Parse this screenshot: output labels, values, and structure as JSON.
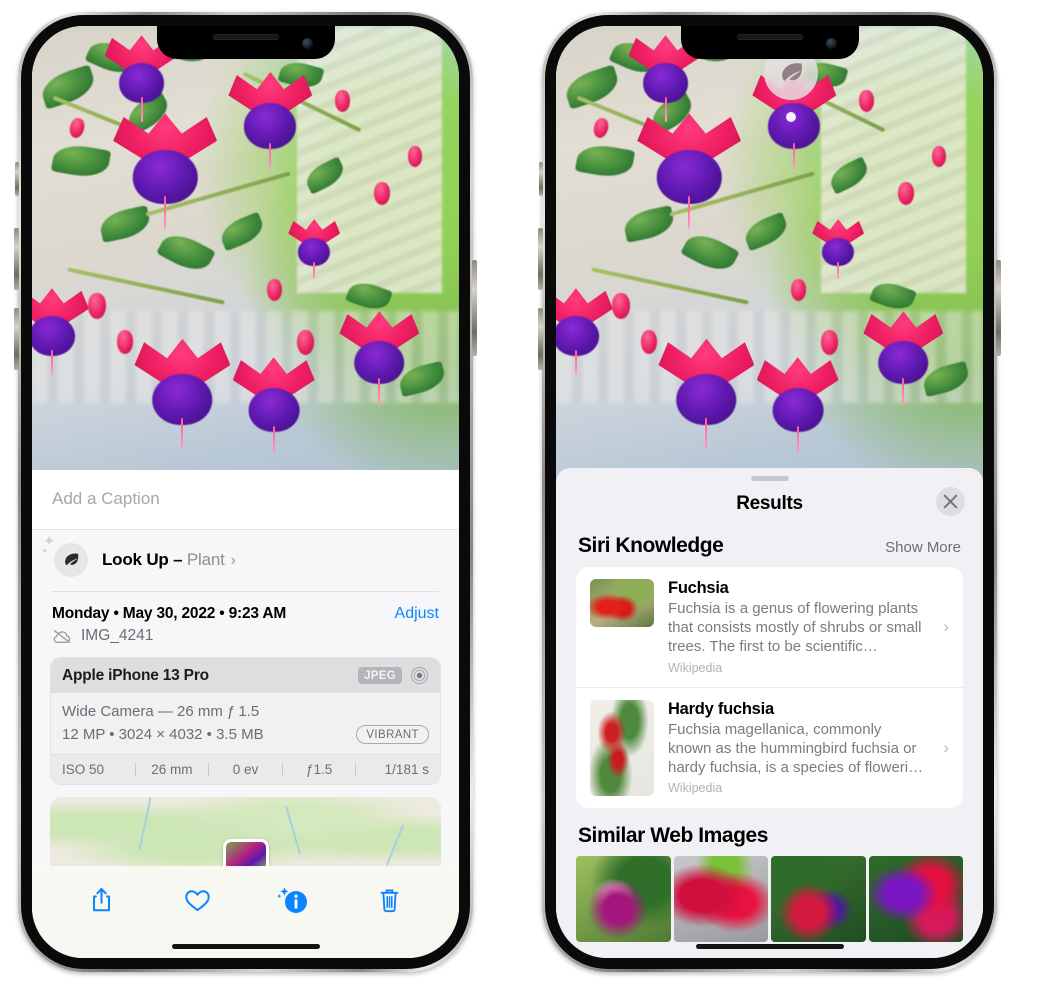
{
  "left_phone": {
    "caption": {
      "placeholder": "Add a Caption",
      "value": ""
    },
    "lookup": {
      "icon": "leaf-icon",
      "label": "Look Up – ",
      "subject": "Plant",
      "chevron": "›"
    },
    "meta": {
      "date": "Monday • May 30, 2022 • 9:23 AM",
      "adjust_label": "Adjust",
      "filename": "IMG_4241",
      "cloud_icon": "cloud-slash-icon"
    },
    "camera_card": {
      "model": "Apple iPhone 13 Pro",
      "format_badge": "JPEG",
      "lens_icon": "lens-icon",
      "lens_line": "Wide Camera — 26 mm ƒ 1.5",
      "size_line": "12 MP • 3024 × 4032 • 3.5 MB",
      "quality_badge": "VIBRANT",
      "exif": [
        "ISO 50",
        "26 mm",
        "0 ev",
        "ƒ1.5",
        "1/181 s"
      ]
    },
    "toolbar": [
      {
        "name": "share-button",
        "icon": "share-icon"
      },
      {
        "name": "favorite-button",
        "icon": "heart-icon"
      },
      {
        "name": "info-button",
        "icon": "info-sparkle-icon"
      },
      {
        "name": "delete-button",
        "icon": "trash-icon"
      }
    ]
  },
  "right_phone": {
    "pin": {
      "icon": "leaf-icon"
    },
    "sheet": {
      "title": "Results",
      "close_label": "✕",
      "siri_knowledge": {
        "heading": "Siri Knowledge",
        "action": "Show More",
        "items": [
          {
            "title": "Fuchsia",
            "description": "Fuchsia is a genus of flowering plants that consists mostly of shrubs or small trees. The first to be scientific…",
            "source": "Wikipedia",
            "chevron": "›"
          },
          {
            "title": "Hardy fuchsia",
            "description": "Fuchsia magellanica, commonly known as the hummingbird fuchsia or hardy fuchsia, is a species of floweri…",
            "source": "Wikipedia",
            "chevron": "›"
          }
        ]
      },
      "similar_web_images": {
        "heading": "Similar Web Images",
        "thumbnails": [
          "fuchsia-thumb-1",
          "fuchsia-thumb-2",
          "fuchsia-thumb-3",
          "fuchsia-thumb-4"
        ]
      }
    }
  },
  "colors": {
    "accent_blue": "#0a84ff",
    "sheet_bg": "#f1f1f5",
    "card_bg": "#ffffff",
    "secondary_text": "#8e8e93"
  }
}
